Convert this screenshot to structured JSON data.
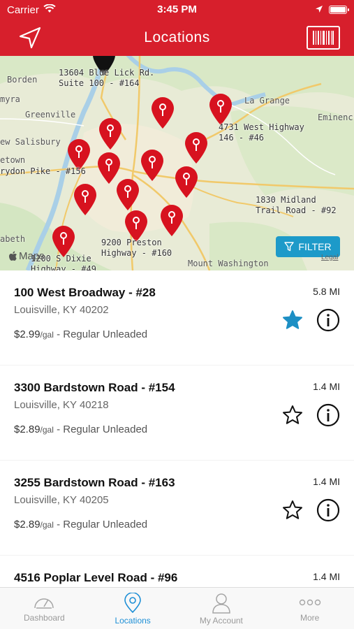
{
  "status_bar": {
    "carrier": "Carrier",
    "time": "3:45 PM"
  },
  "nav": {
    "title": "Locations",
    "left_icon": "location-arrow-icon",
    "right_icon": "barcode-icon"
  },
  "map": {
    "store_labels": [
      {
        "line1": "13604 Blue Lick Rd.",
        "line2": "Suite 100 - #164"
      },
      {
        "line1": "4731 West Highway",
        "line2": "146 - #46"
      },
      {
        "line1": "rydon Pike - #156",
        "line2": ""
      },
      {
        "line1": "1830 Midland",
        "line2": "Trail Road - #92"
      },
      {
        "line1": "9200 Preston",
        "line2": "Highway - #160"
      },
      {
        "line1": "1200 S Dixie",
        "line2": "Highway - #49"
      }
    ],
    "cities": [
      "Borden",
      "myra",
      "Greenville",
      "La Grange",
      "Eminenc",
      "ew Salisbury",
      "etown",
      "abeth",
      "Mount Washington"
    ],
    "filter_label": "FILTER",
    "maps_label": "Maps",
    "legal_label": "Legal",
    "pin_color": "#d7121f"
  },
  "locations": [
    {
      "name": "100 West Broadway - #28",
      "distance": "5.8 MI",
      "city": "Louisville, KY 40202",
      "price": "$2.99",
      "unit": "/gal",
      "fuel": " - Regular Unleaded",
      "favorite": true
    },
    {
      "name": "3300 Bardstown Road - #154",
      "distance": "1.4 MI",
      "city": "Louisville, KY 40218",
      "price": "$2.89",
      "unit": "/gal",
      "fuel": " - Regular Unleaded",
      "favorite": false
    },
    {
      "name": "3255 Bardstown Road - #163",
      "distance": "1.4 MI",
      "city": "Louisville, KY 40205",
      "price": "$2.89",
      "unit": "/gal",
      "fuel": " - Regular Unleaded",
      "favorite": false
    },
    {
      "name": "4516 Poplar Level Road - #96",
      "distance": "1.4 MI",
      "city": "",
      "price": "",
      "unit": "",
      "fuel": "",
      "favorite": false
    }
  ],
  "tabs": [
    {
      "label": "Dashboard",
      "icon": "speedometer-icon",
      "active": false
    },
    {
      "label": "Locations",
      "icon": "map-pin-icon",
      "active": true
    },
    {
      "label": "My Account",
      "icon": "person-icon",
      "active": false
    },
    {
      "label": "More",
      "icon": "more-dots-icon",
      "active": false
    }
  ],
  "colors": {
    "header": "#d71f2c",
    "accent": "#1d9ac9",
    "favorite_star": "#1d8fc4",
    "active_tab": "#1d8fd6"
  }
}
